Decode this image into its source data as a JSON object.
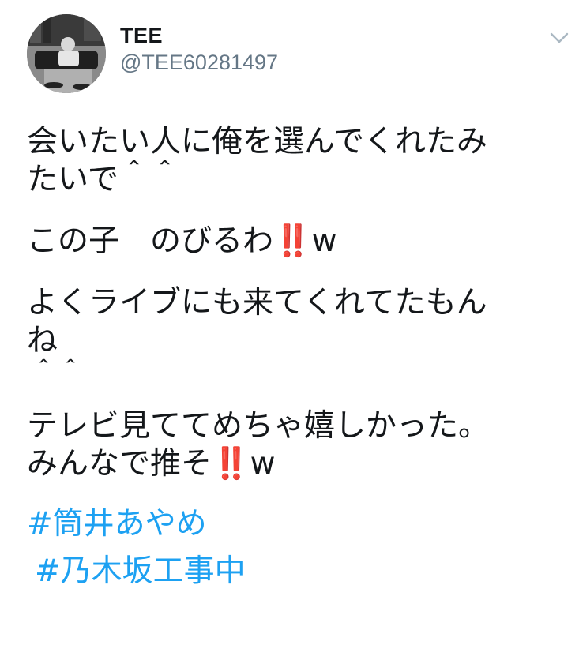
{
  "user": {
    "display_name": "TEE",
    "handle": "@TEE60281497",
    "avatar_icon": "user-avatar-photo"
  },
  "menu": {
    "icon": "chevron-down-icon"
  },
  "tweet": {
    "lines": [
      "会いたい人に俺を選んでくれたみ",
      "たいで＾＾",
      "この子　のびるわ",
      "w",
      "よくライブにも来てくれてたもん",
      "ね",
      "＾＾",
      "テレビ見ててめちゃ嬉しかった。",
      "みんなで推そ",
      "w"
    ],
    "emoji": "‼️",
    "hashtags": [
      "#筒井あやめ",
      "#乃木坂工事中"
    ]
  },
  "colors": {
    "text": "#14171a",
    "secondary": "#657786",
    "link": "#1da1f2",
    "emoji_red": "#d92121"
  }
}
